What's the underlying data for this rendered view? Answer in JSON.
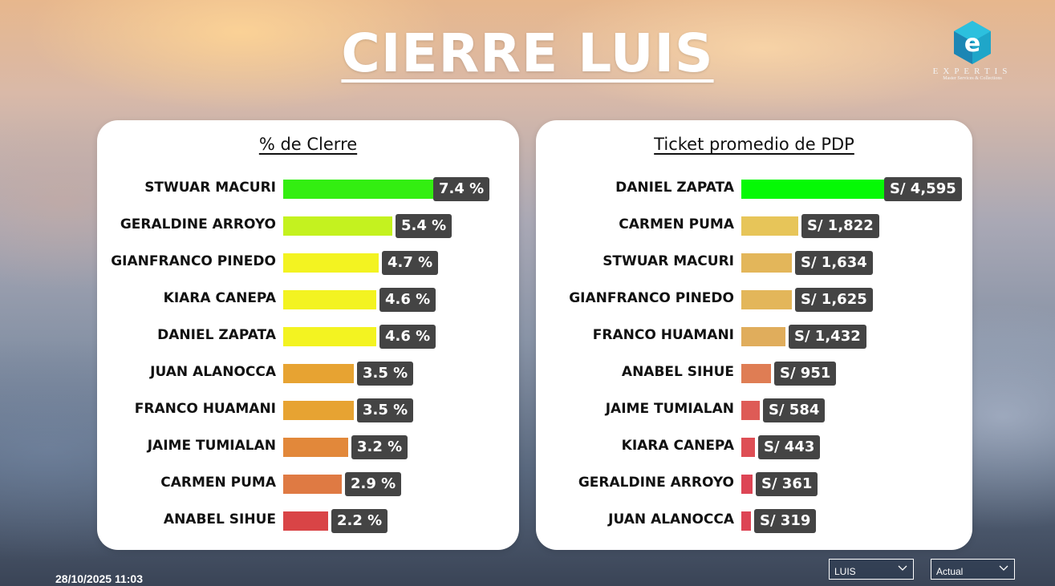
{
  "header": {
    "title": "CIERRE LUIS"
  },
  "logo": {
    "word": "EXPERTIS",
    "subtitle": "Master Services & Collections"
  },
  "footer": {
    "timestamp": "28/10/2025 11:03",
    "slicers": [
      {
        "value": "LUIS"
      },
      {
        "value": "Actual"
      }
    ]
  },
  "chart_data": [
    {
      "type": "bar",
      "orientation": "horizontal",
      "title": "% de Clerre",
      "categories": [
        "STWUAR MACURI",
        "GERALDINE ARROYO",
        "GIANFRANCO PINEDO",
        "KIARA CANEPA",
        "DANIEL ZAPATA",
        "JUAN ALANOCCA",
        "FRANCO HUAMANI",
        "JAIME TUMIALAN",
        "CARMEN PUMA",
        "ANABEL SIHUE"
      ],
      "values": [
        7.4,
        5.4,
        4.7,
        4.6,
        4.6,
        3.5,
        3.5,
        3.2,
        2.9,
        2.2
      ],
      "value_labels": [
        "7.4 %",
        "5.4 %",
        "4.7 %",
        "4.6 %",
        "4.6 %",
        "3.5 %",
        "3.5 %",
        "3.2 %",
        "2.9 %",
        "2.2 %"
      ],
      "colors": [
        "#33ee11",
        "#c4f21f",
        "#f3f321",
        "#f3f321",
        "#f3f321",
        "#e7a332",
        "#e7a332",
        "#e2883a",
        "#df7a43",
        "#d94446"
      ]
    },
    {
      "type": "bar",
      "orientation": "horizontal",
      "title": "Ticket promedio de PDP",
      "categories": [
        "DANIEL ZAPATA",
        "CARMEN PUMA",
        "STWUAR MACURI",
        "GIANFRANCO PINEDO",
        "FRANCO HUAMANI",
        "ANABEL SIHUE",
        "JAIME TUMIALAN",
        "KIARA CANEPA",
        "GERALDINE ARROYO",
        "JUAN ALANOCCA"
      ],
      "values": [
        4595,
        1822,
        1634,
        1625,
        1432,
        951,
        584,
        443,
        361,
        319
      ],
      "value_labels": [
        "S/ 4,595",
        "S/ 1,822",
        "S/ 1,634",
        "S/ 1,625",
        "S/ 1,432",
        "S/ 951",
        "S/ 584",
        "S/ 443",
        "S/ 361",
        "S/ 319"
      ],
      "colors": [
        "#05f905",
        "#e7c559",
        "#e3b65a",
        "#e3b65a",
        "#e0ad5c",
        "#df7d54",
        "#de5b56",
        "#de4e55",
        "#dd4555",
        "#dd4555"
      ]
    }
  ]
}
